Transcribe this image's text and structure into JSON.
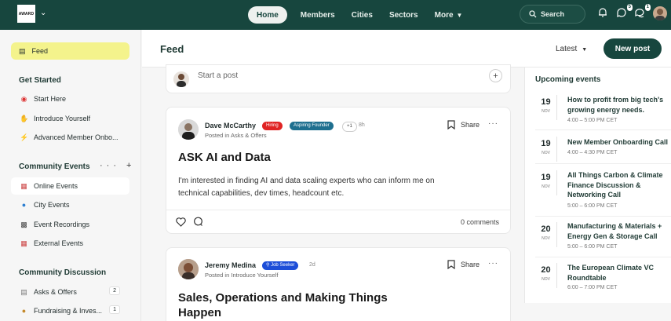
{
  "topbar": {
    "logo_text": "AWARD",
    "nav": [
      "Home",
      "Members",
      "Cities",
      "Sectors",
      "More"
    ],
    "search_label": "Search",
    "chat_badge": "5",
    "messages_badge": "1",
    "colors": {
      "bar": "#17463e",
      "accent": "#f4f38c"
    }
  },
  "sidebar": {
    "feed_label": "Feed",
    "get_started": {
      "title": "Get Started",
      "items": [
        "Start Here",
        "Introduce Yourself",
        "Advanced Member Onbo..."
      ]
    },
    "community_events": {
      "title": "Community Events",
      "actions": "··· +",
      "items": [
        "Online Events",
        "City Events",
        "Event Recordings",
        "External Events"
      ]
    },
    "community_discussion": {
      "title": "Community Discussion",
      "items": [
        {
          "label": "Asks & Offers",
          "count": "2"
        },
        {
          "label": "Fundraising & Inves...",
          "count": "1"
        }
      ]
    }
  },
  "main": {
    "title": "Feed",
    "sort_label": "Latest",
    "new_post_label": "New post",
    "start_post_placeholder": "Start a post",
    "posts": [
      {
        "author": "Dave McCarthy",
        "tags": [
          "Hiring",
          "Aspiring Founder"
        ],
        "extra_tags": "+1",
        "time": "8h",
        "posted_in": "Posted in Asks & Offers",
        "share_label": "Share",
        "title": "ASK AI and Data",
        "body_lines": [
          "I'm interested in finding AI and data scaling experts who can inform me on",
          "technical capabilities, dev times, headcount etc."
        ],
        "comments": "0 comments"
      },
      {
        "author": "Jeremy Medina",
        "tags": [
          "Job Seeker"
        ],
        "time": "2d",
        "posted_in": "Posted in Introduce Yourself",
        "share_label": "Share",
        "title_lines": [
          "Sales, Operations and Making Things",
          "Happen"
        ]
      }
    ]
  },
  "events": {
    "title": "Upcoming events",
    "items": [
      {
        "day": "19",
        "month": "NOV",
        "name_lines": [
          "How to profit from big tech's",
          "growing energy needs."
        ],
        "time": "4:00 – 5:00 PM CET"
      },
      {
        "day": "19",
        "month": "NOV",
        "name_lines": [
          "New Member Onboarding Call"
        ],
        "time": "4:00 – 4:30 PM CET"
      },
      {
        "day": "19",
        "month": "NOV",
        "name_lines": [
          "All Things Carbon & Climate",
          "Finance Discussion &",
          "Networking Call"
        ],
        "time": "5:00 – 6:00 PM CET"
      },
      {
        "day": "20",
        "month": "NOV",
        "name_lines": [
          "Manufacturing & Materials +",
          "Energy Gen & Storage Call"
        ],
        "time": "5:00 – 6:00 PM CET"
      },
      {
        "day": "20",
        "month": "NOV",
        "name_lines": [
          "The European Climate VC",
          "Roundtable"
        ],
        "time": "6:00 – 7:00 PM CET"
      }
    ]
  }
}
